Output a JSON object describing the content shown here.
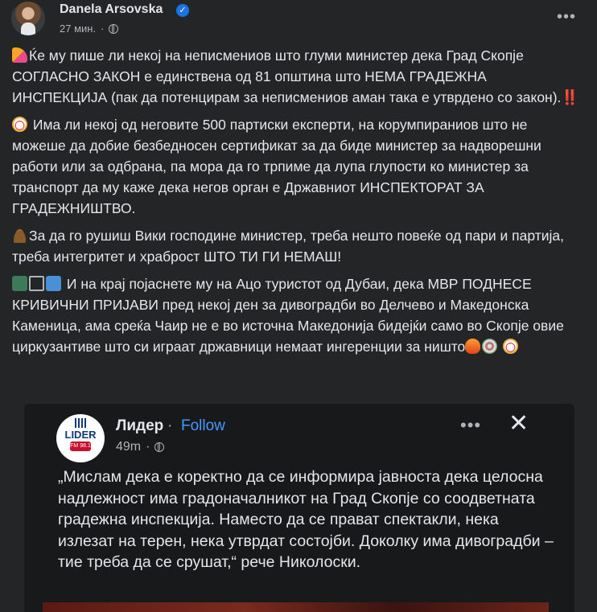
{
  "post": {
    "author": "Danela Arsovska",
    "verified": "✓",
    "time": "27 мин.",
    "separator": "·",
    "more": "•••",
    "paragraphs": [
      "Ќе му пише ли некој на неписмениов што глуми министер дека Град Скопје СОГЛАСНО ЗАКОН е единствена од 81 општина што НЕМА ГРАДЕЖНА ИНСПЕКЦИЈА (пак да потенцирам за неписмениов аман така е утврдено со закон).",
      "Има ли некој од неговите 500 партиски експерти, на корумпираниов што не можеше да добие безбедносен сертификат за да биде министер за надворешни работи или за одбрана, па мора да го трпиме да лупа глупости ко министер за транспорт да му каже дека негов орган е Државниот ИНСПЕКТОРАТ ЗА ГРАДЕЖНИШТВО.",
      "За да го рушиш Вики господине министер, треба нешто повеќе од пари и партија, треба интегритет и храброст ШТО ТИ ГИ НЕМАШ!",
      "И на крај појаснете му на Ацо туристот од Дубаи, дека МВР ПОДНЕСЕ КРИВИЧНИ ПРИЈАВИ пред некој ден за дивоградби во Делчево и Македонска Каменица, ама среќа Чаир не е во источна Македонија бидејќи само во Скопје овие циркузантиве што си играат државници немаат ингеренции за ништо"
    ],
    "exclamation": "‼️"
  },
  "shared": {
    "page_name": "Лидер",
    "dot": "·",
    "follow": "Follow",
    "time": "49m",
    "separator": "·",
    "more": "•••",
    "close": "✕",
    "logo_word": "LIDER",
    "logo_fm": "FM 98.1",
    "quote": "„Мислам дека е коректно да се информира јавноста дека целосна надлежност има градоначалникот на Град Скопје со соодветната градежна инспекција. Наместо да се прават спектакли, нека излезат на терен, нека утврдат состојби. Доколку има дивоградби – тие треба да се срушат,“ рече Николоски."
  },
  "icons": [
    "party-popper-icon",
    "clown-icon",
    "pile-of-poo-icon",
    "money-icon",
    "scales-icon",
    "id-card-icon",
    "fire-icon",
    "ferris-wheel-icon",
    "globe-icon",
    "verified-badge-icon"
  ]
}
